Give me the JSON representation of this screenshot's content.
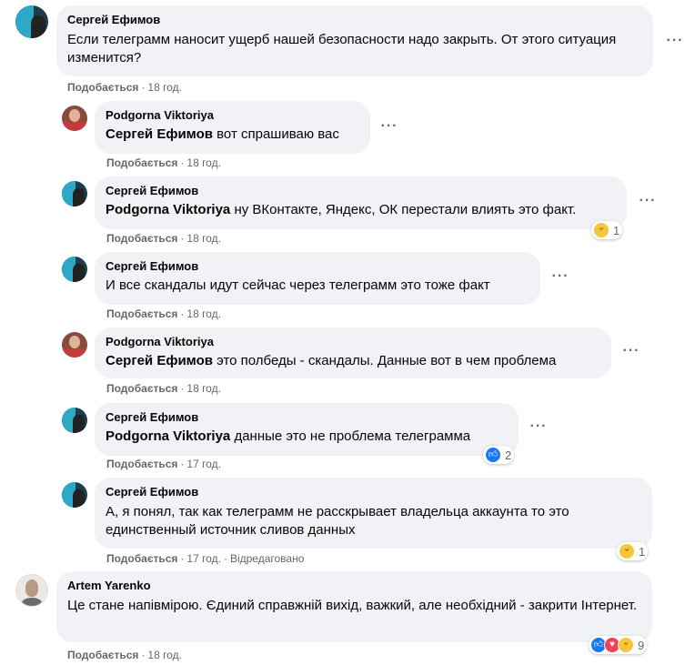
{
  "comments": [
    {
      "author": "Сергей Ефимов",
      "text": "Если телеграмм наносит ущерб нашей безопасности надо закрыть. От этого ситуация изменится?",
      "like": "Подобається",
      "time": "18 год."
    },
    {
      "author": "Podgorna Viktoriya",
      "mention": "Сергей Ефимов",
      "text": "вот спрашиваю вас",
      "like": "Подобається",
      "time": "18 год."
    },
    {
      "author": "Сергей Ефимов",
      "mention": "Podgorna Viktoriya",
      "text": "ну ВКонтакте, Яндекс, ОК перестали влиять это факт.",
      "like": "Подобається",
      "time": "18 год.",
      "reaction_count": "1"
    },
    {
      "author": "Сергей Ефимов",
      "text": "И все скандалы идут сейчас через телеграмм это тоже факт",
      "like": "Подобається",
      "time": "18 год."
    },
    {
      "author": "Podgorna Viktoriya",
      "mention": "Сергей Ефимов",
      "text": "это полбеды - скандалы. Данные вот в чем проблема",
      "like": "Подобається",
      "time": "18 год."
    },
    {
      "author": "Сергей Ефимов",
      "mention": "Podgorna Viktoriya",
      "text": "данные это не проблема телеграмма",
      "like": "Подобається",
      "time": "17 год.",
      "reaction_count": "2"
    },
    {
      "author": "Сергей Ефимов",
      "text": "А, я понял, так как телеграмм не расскрывает владельца аккаунта то это единственный источник сливов данных",
      "like": "Подобається",
      "time": "17 год.",
      "edited": "Відредаговано",
      "reaction_count": "1"
    },
    {
      "author": "Artem Yarenko",
      "text": "Це стане напівмірою. Єдиний справжній вихід, важкий, але необхідний - закрити Інтернет.",
      "like": "Подобається",
      "time": "18 год.",
      "reaction_count": "9"
    }
  ],
  "separator": "·",
  "icons": {
    "more": "more-options-icon",
    "haha": "haha-reaction-icon",
    "like": "like-reaction-icon",
    "love": "love-reaction-icon"
  },
  "colors": {
    "bubble": "#f0f2f5",
    "meta": "#65676b",
    "like_blue": "#1877f2",
    "love_red": "#f33e58",
    "haha_yellow": "#f7c53a"
  }
}
